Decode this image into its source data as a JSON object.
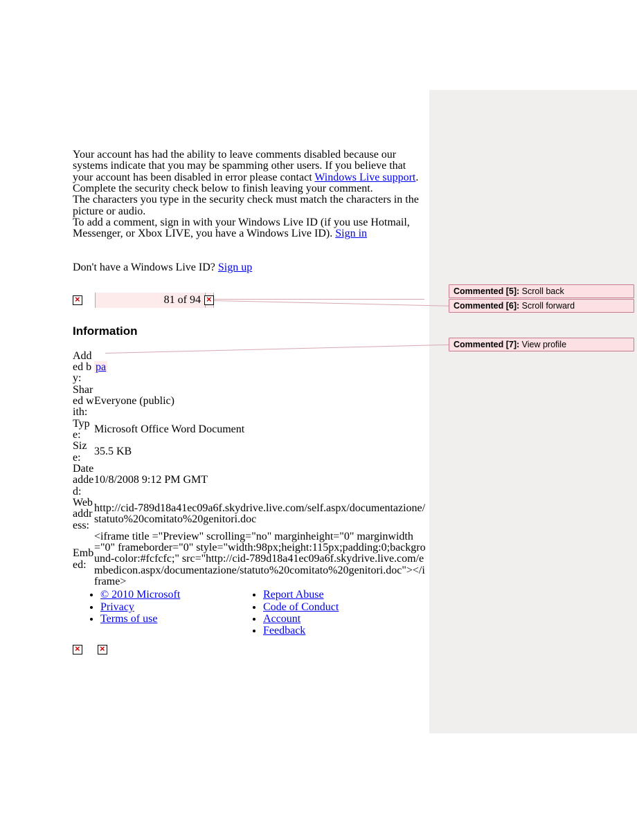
{
  "notice": {
    "disabled_text_pre": "Your account has had the ability to leave comments disabled because our systems indicate that you may be spamming other users. If you believe that your account has been disabled in error please contact ",
    "support_link": "Windows Live support",
    "disabled_text_post": ".",
    "complete_check": "Complete the security check below to finish leaving your comment.",
    "char_match": "The characters you type in the security check must match the characters in the picture or audio.",
    "signin_pre": "To add a comment, sign in with your Windows Live ID (if you use Hotmail, Messenger, or Xbox LIVE, you have a Windows Live ID). ",
    "signin_link": "Sign in",
    "signup_pre": "Don't have a Windows Live ID? ",
    "signup_link": "Sign up"
  },
  "pager": {
    "label": "81 of 94"
  },
  "info": {
    "heading": "Information",
    "added_by_label": "Added by:",
    "added_by_link": "pa",
    "shared_label": "Shared with:",
    "shared_value": "Everyone (public)",
    "type_label": "Type:",
    "type_value": "Microsoft Office Word Document",
    "size_label": "Size:",
    "size_value": "35.5 KB",
    "date_label": "Date added:",
    "date_value": "10/8/2008 9:12 PM GMT",
    "web_label": "Web address:",
    "web_value": "http://cid-789d18a41ec09a6f.skydrive.live.com/self.aspx/documentazione/statuto%20comitato%20genitori.doc",
    "embed_label": "Embed:",
    "embed_value": "<iframe title =\"Preview\" scrolling=\"no\" marginheight=\"0\" marginwidth=\"0\" frameborder=\"0\" style=\"width:98px;height:115px;padding:0;background-color:#fcfcfc;\" src=\"http://cid-789d18a41ec09a6f.skydrive.live.com/embedicon.aspx/documentazione/statuto%20comitato%20genitori.doc\"></iframe>"
  },
  "footer": {
    "copyright": "© 2010 Microsoft",
    "privacy": "Privacy",
    "terms": "Terms of use",
    "report": "Report Abuse",
    "conduct": "Code of Conduct",
    "account": "Account",
    "feedback": "Feedback"
  },
  "comments": {
    "c5_label": "Commented [5]:",
    "c5_text": "  Scroll back",
    "c6_label": "Commented [6]:",
    "c6_text": "  Scroll forward",
    "c7_label": "Commented [7]:",
    "c7_text": "  View profile"
  }
}
